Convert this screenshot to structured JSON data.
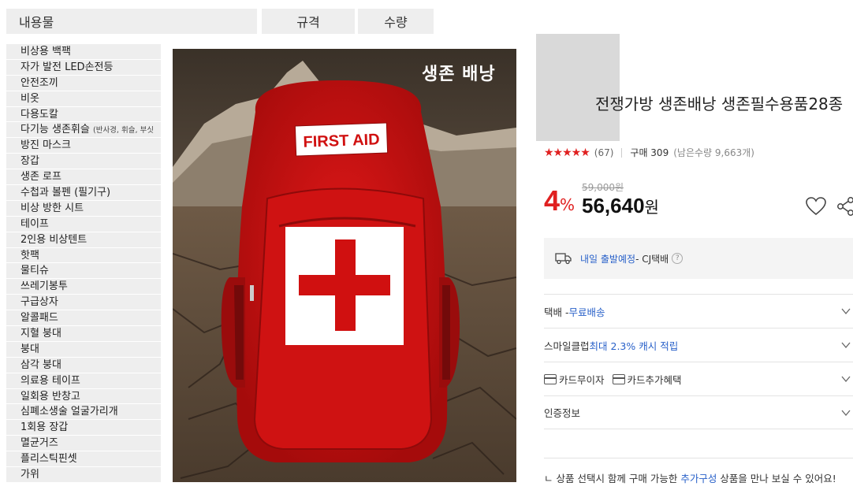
{
  "table": {
    "headers": {
      "content": "내용물",
      "spec": "규격",
      "quantity": "수량"
    },
    "items": [
      {
        "label": "비상용 백팩",
        "sub": ""
      },
      {
        "label": "자가 발전 LED손전등",
        "sub": ""
      },
      {
        "label": "안전조끼",
        "sub": ""
      },
      {
        "label": "비옷",
        "sub": ""
      },
      {
        "label": "다용도칼",
        "sub": ""
      },
      {
        "label": "다기능 생존휘슬",
        "sub": "(반사경, 휘슬, 부싯"
      },
      {
        "label": "방진 마스크",
        "sub": ""
      },
      {
        "label": "장갑",
        "sub": ""
      },
      {
        "label": "생존 로프",
        "sub": ""
      },
      {
        "label": "수첩과 볼펜 (필기구)",
        "sub": ""
      },
      {
        "label": "비상 방한 시트",
        "sub": ""
      },
      {
        "label": "테이프",
        "sub": ""
      },
      {
        "label": "2인용 비상텐트",
        "sub": ""
      },
      {
        "label": "핫팩",
        "sub": ""
      },
      {
        "label": "물티슈",
        "sub": ""
      },
      {
        "label": "쓰레기봉투",
        "sub": ""
      },
      {
        "label": "구급상자",
        "sub": ""
      },
      {
        "label": "알콜패드",
        "sub": ""
      },
      {
        "label": "지혈 붕대",
        "sub": ""
      },
      {
        "label": "붕대",
        "sub": ""
      },
      {
        "label": "삼각 붕대",
        "sub": ""
      },
      {
        "label": "의료용 테이프",
        "sub": ""
      },
      {
        "label": "일회용 반창고",
        "sub": ""
      },
      {
        "label": "심폐소생술 얼굴가리개",
        "sub": ""
      },
      {
        "label": "1회용 장갑",
        "sub": ""
      },
      {
        "label": "멸균거즈",
        "sub": ""
      },
      {
        "label": "플리스틱핀셋",
        "sub": ""
      },
      {
        "label": "가위",
        "sub": ""
      }
    ]
  },
  "image": {
    "caption": "생존 배낭",
    "patch_text": "FIRST AID"
  },
  "product": {
    "title": "전쟁가방 생존배낭 생존필수용품28종",
    "rating_stars": "★★★★★",
    "review_count": "(67)",
    "purchase_count": "구매 309",
    "remaining": "(남은수량 9,663개)",
    "original_price": "59,000원",
    "discount_number": "4",
    "discount_unit": "%",
    "sale_price": "56,640",
    "sale_unit": "원"
  },
  "delivery": {
    "when": "내일 출발예정",
    "carrier": " - CJ택배",
    "help": "?"
  },
  "rows": {
    "shipping_label": "택배 - ",
    "shipping_value": "무료배송",
    "smile_label": "스마일클럽 ",
    "smile_value": "최대 2.3% 캐시 적립",
    "card_interest": "카드무이자",
    "card_benefit": "카드추가혜택",
    "cert": "인증정보"
  },
  "addon": {
    "prefix": "ㄴ 상품 선택시 함께 구매 가능한 ",
    "link": "추가구성",
    "suffix": " 상품을 만나 보실 수 있어요!"
  },
  "colors": {
    "accent_red": "#e02020",
    "link_blue": "#2961c9",
    "table_bg": "#eeeeee"
  }
}
